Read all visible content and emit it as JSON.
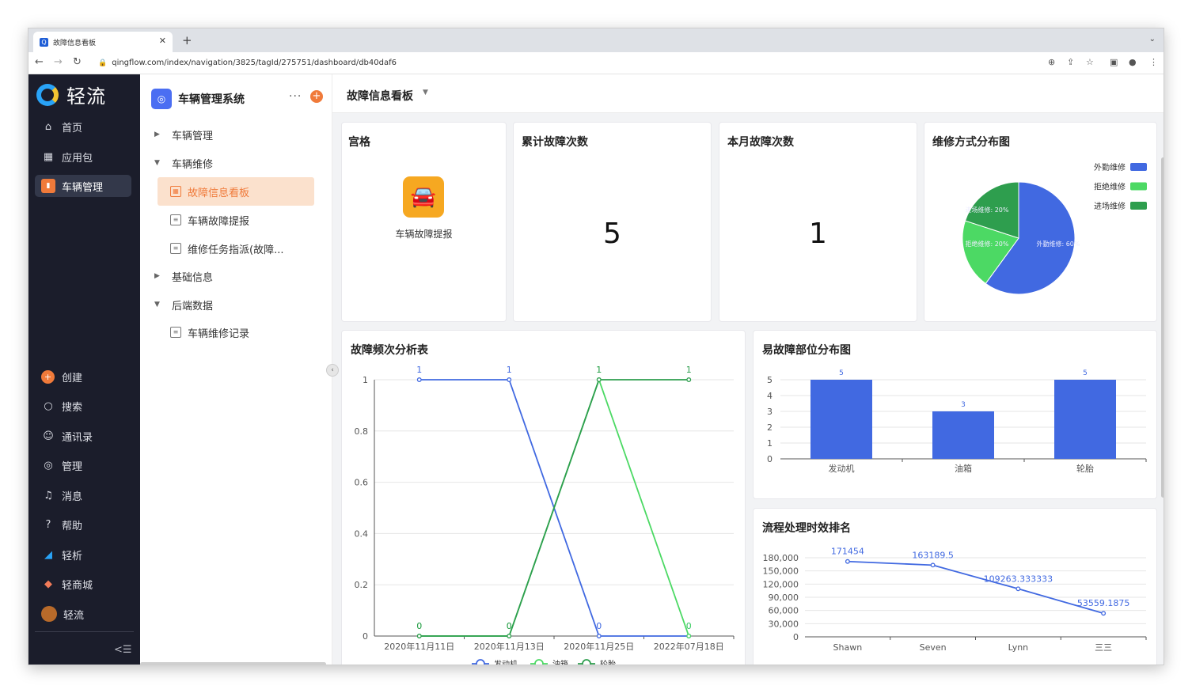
{
  "browser": {
    "tab_title": "故障信息看板",
    "url": "qingflow.com/index/navigation/3825/tagId/275751/dashboard/db40daf6"
  },
  "nav": {
    "brand": "轻流",
    "items": [
      {
        "label": "首页",
        "icon": "home-icon"
      },
      {
        "label": "应用包",
        "icon": "apps-icon"
      },
      {
        "label": "车辆管理",
        "icon": "app-icon"
      }
    ],
    "bottom_items": [
      {
        "label": "创建",
        "icon": "plus-icon"
      },
      {
        "label": "搜索",
        "icon": "search-icon"
      },
      {
        "label": "通讯录",
        "icon": "contacts-icon"
      },
      {
        "label": "管理",
        "icon": "gear-icon"
      },
      {
        "label": "消息",
        "icon": "bell-icon"
      },
      {
        "label": "帮助",
        "icon": "help-icon"
      },
      {
        "label": "轻析",
        "icon": "analytics-icon"
      },
      {
        "label": "轻商城",
        "icon": "store-icon"
      },
      {
        "label": "轻流",
        "icon": "avatar-icon"
      }
    ]
  },
  "tree": {
    "app_title": "车辆管理系统",
    "items": [
      {
        "label": "车辆管理"
      },
      {
        "label": "车辆维修"
      },
      {
        "label": "故障信息看板"
      },
      {
        "label": "车辆故障提报"
      },
      {
        "label": "维修任务指派(故障..."
      },
      {
        "label": "基础信息"
      },
      {
        "label": "后端数据"
      },
      {
        "label": "车辆维修记录"
      }
    ]
  },
  "dashboard": {
    "title": "故障信息看板",
    "grid_card": {
      "title": "宫格",
      "item_label": "车辆故障提报"
    },
    "total_card": {
      "title": "累计故障次数",
      "value": "5"
    },
    "month_card": {
      "title": "本月故障次数",
      "value": "1"
    },
    "pie_title": "维修方式分布图",
    "line_title": "故障频次分析表",
    "bar_title": "易故障部位分布图",
    "rank_title": "流程处理时效排名"
  },
  "colors": {
    "accent": "#f07a3a",
    "blue": "#4169e1",
    "lightgreen": "#4cd964",
    "darkgreen": "#2e9e4e",
    "nav_bg": "#1b1d2b"
  },
  "chart_data": [
    {
      "type": "pie",
      "title": "维修方式分布图",
      "slices": [
        {
          "name": "外勤维修",
          "label": "外勤维修: 60%",
          "value": 60,
          "color": "#4169e1"
        },
        {
          "name": "拒绝维修",
          "label": "拒绝维修: 20%",
          "value": 20,
          "color": "#4cd964"
        },
        {
          "name": "进场维修",
          "label": "进场维修: 20%",
          "value": 20,
          "color": "#2e9e4e"
        }
      ],
      "legend": "top-right"
    },
    {
      "type": "line",
      "title": "故障频次分析表",
      "categories": [
        "2020年11月11日",
        "2020年11月13日",
        "2020年11月25日",
        "2022年07月18日"
      ],
      "series": [
        {
          "name": "发动机",
          "values": [
            1,
            1,
            0,
            0
          ],
          "color": "#4169e1"
        },
        {
          "name": "油箱",
          "values": [
            0,
            0,
            1,
            0
          ],
          "color": "#4cd964"
        },
        {
          "name": "轮胎",
          "values": [
            0,
            0,
            1,
            1
          ],
          "color": "#2e9e4e"
        }
      ],
      "ylim": [
        0,
        1
      ],
      "yticks": [
        "0",
        "0.2",
        "0.4",
        "0.6",
        "0.8",
        "1"
      ],
      "legend": "bottom"
    },
    {
      "type": "bar",
      "title": "易故障部位分布图",
      "categories": [
        "发动机",
        "油箱",
        "轮胎"
      ],
      "values": [
        5,
        3,
        5
      ],
      "ylim": [
        0,
        5
      ],
      "yticks": [
        "0",
        "1",
        "2",
        "3",
        "4",
        "5"
      ]
    },
    {
      "type": "line",
      "title": "流程处理时效排名",
      "categories": [
        "Shawn",
        "Seven",
        "Lynn",
        "三三"
      ],
      "values": [
        171454,
        163189.5,
        109263.333333,
        53559.1875
      ],
      "value_labels": [
        "171454",
        "163189.5",
        "109263.333333",
        "53559.1875"
      ],
      "ylim": [
        0,
        180000
      ],
      "yticks": [
        "0",
        "30,000",
        "60,000",
        "90,000",
        "120,000",
        "150,000",
        "180,000"
      ]
    }
  ]
}
